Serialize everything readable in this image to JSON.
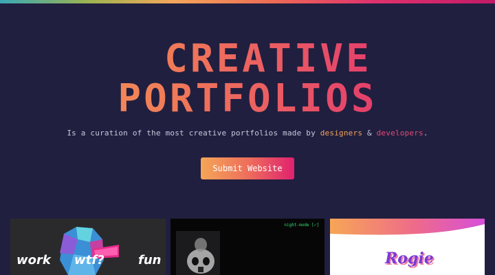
{
  "hero": {
    "title_line1": "CREATIVE",
    "title_line2": "PORTFOLIOS",
    "tagline_prefix": "Is a curation of the most creative portfolios made by ",
    "tagline_designers": "designers",
    "tagline_and": " & ",
    "tagline_developers": "developers",
    "tagline_suffix": ".",
    "submit_label": "Submit Website"
  },
  "cards": [
    {
      "words": [
        "work",
        "wtf?",
        "fun"
      ]
    },
    {
      "mode_label": "night-mode [✓]"
    },
    {
      "logo_text": "Rogie"
    }
  ],
  "colors": {
    "background": "#211f3f",
    "accent_orange": "#f4a658",
    "accent_pink": "#e0226f",
    "designers_link": "#f2a35a",
    "developers_link": "#e34a79"
  }
}
